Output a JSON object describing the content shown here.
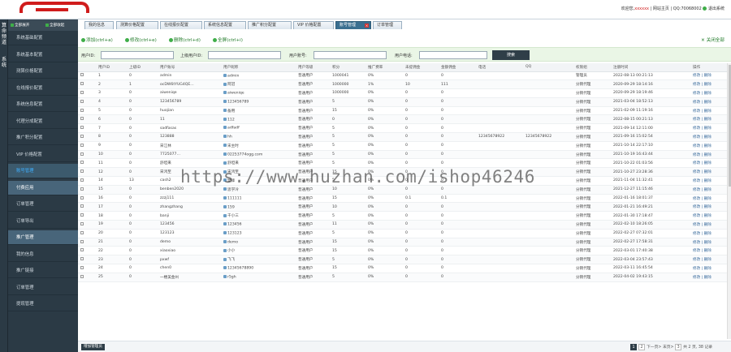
{
  "colors": {
    "brand_red": "#d01c1c",
    "nav_bg": "#2b3a45",
    "nav_active_text": "#3fb0ff",
    "toolbar_green": "#3fae49",
    "search_bg": "#eaf6e6"
  },
  "side_vertical": [
    "算",
    "命",
    "频",
    "道",
    "系",
    "统"
  ],
  "tool_row": {
    "btn1": "全部展开",
    "btn2": "全部收起"
  },
  "tabs": [
    {
      "label": "我的信息"
    },
    {
      "label": "测算价格配置"
    },
    {
      "label": "在线报价配置"
    },
    {
      "label": "系统信息配置"
    },
    {
      "label": "推广积分配置"
    },
    {
      "label": "VIP 价格配置"
    },
    {
      "label": "账号管理",
      "active": true
    },
    {
      "label": "订单管理"
    }
  ],
  "topright": {
    "welcome": "欢迎您,",
    "user": "xxxxxx",
    "home": "| 网站主页 |",
    "qq": "QQ:70068002",
    "logout": "退出系统"
  },
  "nav": [
    {
      "label": "系统基础配置",
      "kind": "normal"
    },
    {
      "label": "系统基本配置",
      "kind": "normal"
    },
    {
      "label": "测算价格配置",
      "kind": "normal"
    },
    {
      "label": "在线报价配置",
      "kind": "normal"
    },
    {
      "label": "系统信息配置",
      "kind": "normal"
    },
    {
      "label": "代理分成配置",
      "kind": "normal"
    },
    {
      "label": "推广积分配置",
      "kind": "normal"
    },
    {
      "label": "VIP 价格配置",
      "kind": "normal"
    },
    {
      "label": "账号管理",
      "kind": "active"
    },
    {
      "label": "付费应用",
      "kind": "group"
    },
    {
      "label": "订单管理",
      "kind": "normal"
    },
    {
      "label": "订单导出",
      "kind": "normal"
    },
    {
      "label": "推广管理",
      "kind": "group"
    },
    {
      "label": "我的信息",
      "kind": "normal"
    },
    {
      "label": "推广链接",
      "kind": "normal"
    },
    {
      "label": "订单管理",
      "kind": "normal"
    },
    {
      "label": "提现管理",
      "kind": "normal"
    }
  ],
  "toolbar": {
    "add": "添加(ctrl+a)",
    "edit": "修改(ctrl+e)",
    "del": "删除(ctrl+d)",
    "all": "全屏(ctrl+i)",
    "closeall": "关闭全部"
  },
  "search": {
    "userid": "用户ID:",
    "agentid": "上级用户ID:",
    "account": "用户账号:",
    "phone": "用户电话:",
    "submit": "搜索"
  },
  "table": {
    "headers": [
      "用户ID",
      "上级ID",
      "用户账号",
      "用户昵称",
      "用户等级",
      "积分",
      "推广费率",
      "未提佣金",
      "金额佣金",
      "电话",
      "QQ",
      "权限组",
      "注册时间",
      "操作"
    ],
    "rows": [
      [
        "1",
        "0",
        "admin",
        "admin",
        "普通用户",
        "1000041",
        "0%",
        "0",
        "0",
        "",
        "",
        "管理员",
        "2022-08-13 00:21:13",
        "修改 | 删除"
      ],
      [
        "2",
        "1",
        "ocDW6tYUG4QE...",
        "阿冠",
        "普通用户",
        "1000000",
        "1%",
        "10",
        "111",
        "",
        "",
        "分销代理",
        "2020-09-29 18:14:16",
        "修改 | 删除"
      ],
      [
        "3",
        "0",
        "aiweniqe",
        "aiweniqe",
        "普通用户",
        "1000000",
        "0%",
        "0",
        "0",
        "",
        "",
        "分销代理",
        "2020-09-29 18:19:46",
        "修改 | 删除"
      ],
      [
        "4",
        "0",
        "123456789",
        "123456789",
        "普通用户",
        "5",
        "0%",
        "0",
        "0",
        "",
        "",
        "分销代理",
        "2021-03-04 18:52:13",
        "修改 | 删除"
      ],
      [
        "5",
        "0",
        "huojian",
        "备用",
        "普通用户",
        "15",
        "0%",
        "0",
        "0",
        "",
        "",
        "分销代理",
        "2021-02-09 11:19:16",
        "修改 | 删除"
      ],
      [
        "6",
        "0",
        "11",
        "112",
        "普通用户",
        "0",
        "0%",
        "0",
        "0",
        "",
        "",
        "分销代理",
        "2022-08-15 00:21:13",
        "修改 | 删除"
      ],
      [
        "7",
        "0",
        "sadfasas",
        "adfadf",
        "普通用户",
        "5",
        "0%",
        "0",
        "0",
        "",
        "",
        "分销代理",
        "2021-09-14 12:11:00",
        "修改 | 删除"
      ],
      [
        "8",
        "0",
        "123888",
        "hh",
        "普通用户",
        "5",
        "0%",
        "0",
        "0",
        "12345678922",
        "12345678922",
        "分销代理",
        "2021-09-16 15:02:54",
        "修改 | 删除"
      ],
      [
        "9",
        "0",
        "宋江林",
        "宋主时",
        "普通用户",
        "5",
        "0%",
        "0",
        "0",
        "",
        "",
        "分销代理",
        "2021-10-14 22:17:10",
        "修改 | 删除"
      ],
      [
        "10",
        "0",
        "7725077…",
        "02253774ogg.com",
        "普通用户",
        "5",
        "0%",
        "0",
        "0",
        "",
        "",
        "分销代理",
        "2021-10-19 16:43:44",
        "修改 | 删除"
      ],
      [
        "11",
        "0",
        "舒坦来",
        "舒坦来",
        "普通用户",
        "5",
        "0%",
        "0",
        "0",
        "",
        "",
        "分销代理",
        "2021-10-22 01:03:56",
        "修改 | 删除"
      ],
      [
        "12",
        "0",
        "宋鸿至",
        "宋鸿至",
        "普通用户",
        "15",
        "0%",
        "0",
        "0",
        "",
        "",
        "分销代理",
        "2021-10-27 23:28:36",
        "修改 | 删除"
      ],
      [
        "14",
        "13",
        "cash2",
        "樊锋",
        "普通用户",
        "5",
        "0%",
        "0",
        "0",
        "",
        "",
        "分销代理",
        "2021-11-04 11:32:41",
        "修改 | 删除"
      ],
      [
        "15",
        "0",
        "benben2020",
        "思学冷",
        "普通用户",
        "10",
        "0%",
        "0",
        "0",
        "",
        "",
        "分销代理",
        "2021-12-27 11:15:46",
        "修改 | 删除"
      ],
      [
        "16",
        "0",
        "zzzj111",
        "111111",
        "普通用户",
        "15",
        "0%",
        "0.1",
        "0.1",
        "",
        "",
        "分销代理",
        "2022-01-16 18:01:37",
        "修改 | 删除"
      ],
      [
        "17",
        "0",
        "zhangzhang",
        "159",
        "普通用户",
        "10",
        "0%",
        "0",
        "0",
        "",
        "",
        "分销代理",
        "2022-01-21 16:49:21",
        "修改 | 删除"
      ],
      [
        "18",
        "0",
        "banji",
        "干小三",
        "普通用户",
        "5",
        "0%",
        "0",
        "0",
        "",
        "",
        "分销代理",
        "2022-01-30 17:18:47",
        "修改 | 删除"
      ],
      [
        "19",
        "0",
        "123456",
        "123456",
        "普通用户",
        "11",
        "0%",
        "0",
        "0",
        "",
        "",
        "分销代理",
        "2022-02-10 18:26:05",
        "修改 | 删除"
      ],
      [
        "20",
        "0",
        "123123",
        "123123",
        "普通用户",
        "5",
        "0%",
        "0",
        "0",
        "",
        "",
        "分销代理",
        "2022-02-27 07:32:01",
        "修改 | 删除"
      ],
      [
        "21",
        "0",
        "demo",
        "demo",
        "普通用户",
        "15",
        "0%",
        "0",
        "0",
        "",
        "",
        "分销代理",
        "2022-02-27 17:58:31",
        "修改 | 删除"
      ],
      [
        "22",
        "0",
        "xiaoxiao",
        "小小",
        "普通用户",
        "15",
        "0%",
        "0",
        "0",
        "",
        "",
        "分销代理",
        "2022-03-01 17:40:38",
        "修改 | 删除"
      ],
      [
        "23",
        "0",
        "pxwf",
        "飞飞",
        "普通用户",
        "5",
        "0%",
        "0",
        "0",
        "",
        "",
        "分销代理",
        "2022-03-04 23:57:43",
        "修改 | 删除"
      ],
      [
        "24",
        "0",
        "chen0",
        "12345678890",
        "普通用户",
        "15",
        "0%",
        "0",
        "0",
        "",
        "",
        "分销代理",
        "2022-03-11 16:45:54",
        "修改 | 删除"
      ],
      [
        "25",
        "0",
        "一楼美金州",
        "r5gh",
        "普通用户",
        "5",
        "0%",
        "0",
        "0",
        "",
        "",
        "分销代理",
        "2022-04-02 19:43:15",
        "修改 | 删除"
      ]
    ]
  },
  "footer": {
    "export": "增加管理员",
    "pages": [
      "1",
      "2",
      "3"
    ],
    "current_page": "1",
    "next": "下一页>",
    "last": "末页>",
    "info": "共 2 页, 38 记录"
  },
  "watermark": "https://www.huzhan.com/ishop46246"
}
